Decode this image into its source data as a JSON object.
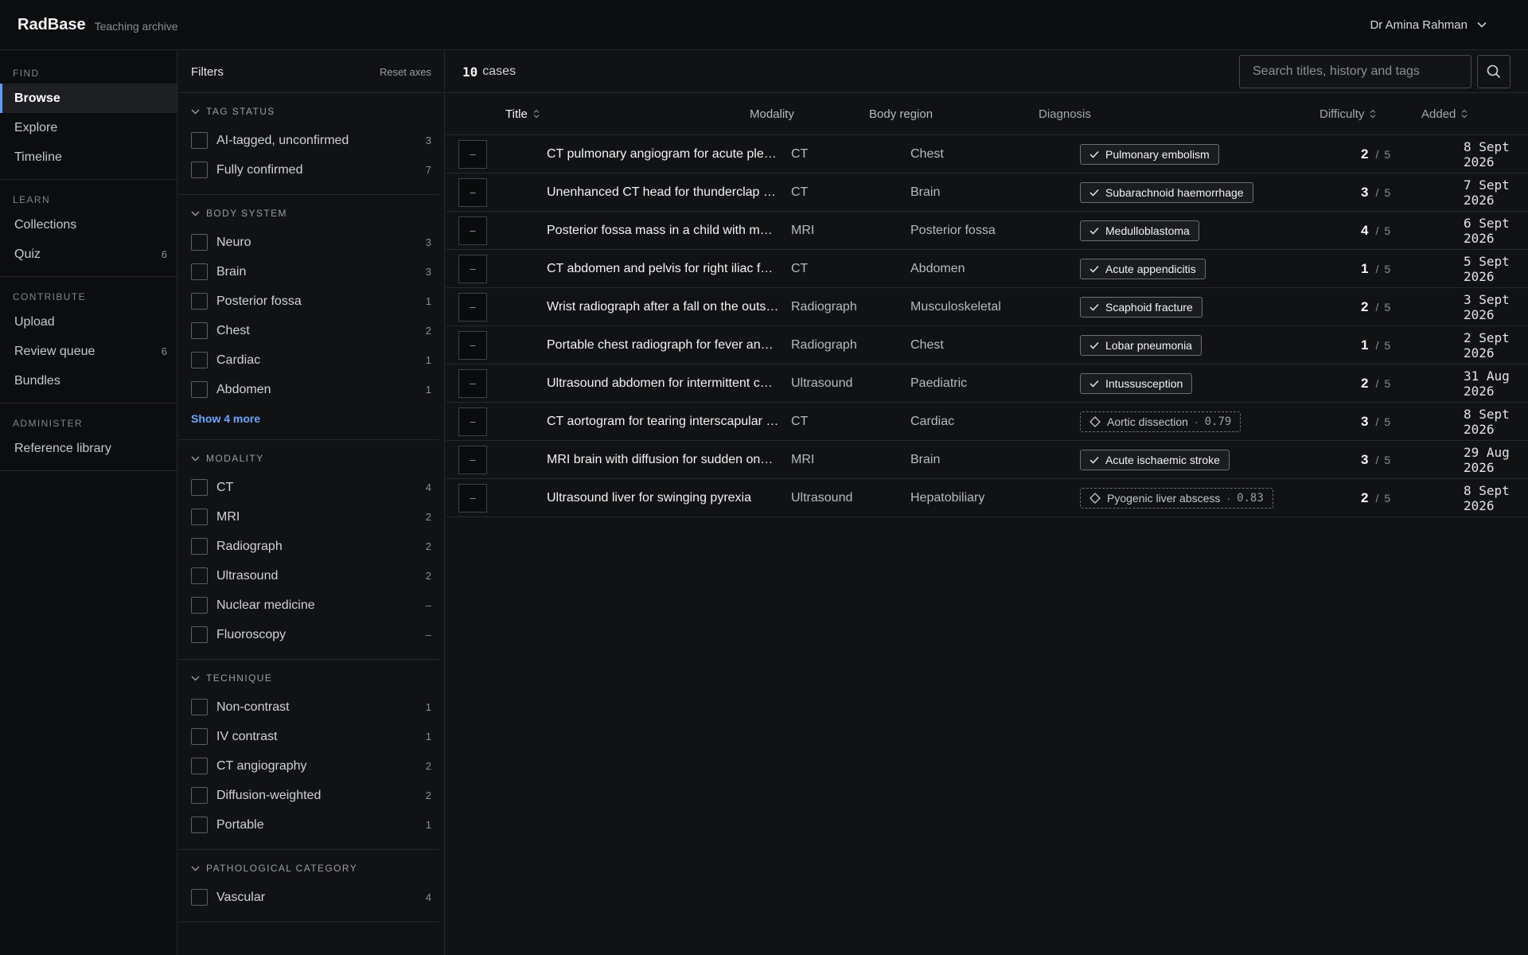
{
  "app": {
    "name": "RadBase",
    "subtitle": "Teaching archive",
    "user": "Dr Amina Rahman"
  },
  "nav": {
    "sections": [
      {
        "heading": "FIND",
        "items": [
          {
            "label": "Browse",
            "active": true
          },
          {
            "label": "Explore"
          },
          {
            "label": "Timeline"
          }
        ]
      },
      {
        "heading": "LEARN",
        "items": [
          {
            "label": "Collections"
          },
          {
            "label": "Quiz",
            "count": "6"
          }
        ]
      },
      {
        "heading": "CONTRIBUTE",
        "items": [
          {
            "label": "Upload"
          },
          {
            "label": "Review queue",
            "count": "6"
          },
          {
            "label": "Bundles"
          }
        ]
      },
      {
        "heading": "ADMINISTER",
        "items": [
          {
            "label": "Reference library"
          }
        ]
      }
    ]
  },
  "filters": {
    "title": "Filters",
    "reset_label": "Reset axes",
    "show_more_label": "Show 4 more",
    "groups": [
      {
        "title": "TAG STATUS",
        "options": [
          {
            "label": "AI-tagged, unconfirmed",
            "count": "3"
          },
          {
            "label": "Fully confirmed",
            "count": "7"
          }
        ]
      },
      {
        "title": "BODY SYSTEM",
        "options": [
          {
            "label": "Neuro",
            "count": "3"
          },
          {
            "label": "Brain",
            "count": "3"
          },
          {
            "label": "Posterior fossa",
            "count": "1"
          },
          {
            "label": "Chest",
            "count": "2"
          },
          {
            "label": "Cardiac",
            "count": "1"
          },
          {
            "label": "Abdomen",
            "count": "1"
          }
        ]
      },
      {
        "title": "MODALITY",
        "options": [
          {
            "label": "CT",
            "count": "4"
          },
          {
            "label": "MRI",
            "count": "2"
          },
          {
            "label": "Radiograph",
            "count": "2"
          },
          {
            "label": "Ultrasound",
            "count": "2"
          },
          {
            "label": "Nuclear medicine",
            "count": "–"
          },
          {
            "label": "Fluoroscopy",
            "count": "–"
          }
        ]
      },
      {
        "title": "TECHNIQUE",
        "options": [
          {
            "label": "Non-contrast",
            "count": "1"
          },
          {
            "label": "IV contrast",
            "count": "1"
          },
          {
            "label": "CT angiography",
            "count": "2"
          },
          {
            "label": "Diffusion-weighted",
            "count": "2"
          },
          {
            "label": "Portable",
            "count": "1"
          }
        ]
      },
      {
        "title": "PATHOLOGICAL CATEGORY",
        "options": [
          {
            "label": "Vascular",
            "count": "4"
          }
        ]
      }
    ]
  },
  "results": {
    "count": "10",
    "count_label": "cases",
    "search_placeholder": "Search titles, history and tags",
    "columns": {
      "title": "Title",
      "modality": "Modality",
      "body_region": "Body region",
      "diagnosis": "Diagnosis",
      "difficulty": "Difficulty",
      "added": "Added"
    },
    "rows": [
      {
        "title": "CT pulmonary angiogram for acute pleuritic chest pain",
        "modality": "CT",
        "body_region": "Chest",
        "diagnosis": "Pulmonary embolism",
        "confirmed": true,
        "difficulty": "2",
        "difficulty_max": "5",
        "added": "8 Sept 2026"
      },
      {
        "title": "Unenhanced CT head for thunderclap headache",
        "modality": "CT",
        "body_region": "Brain",
        "diagnosis": "Subarachnoid haemorrhage",
        "confirmed": true,
        "difficulty": "3",
        "difficulty_max": "5",
        "added": "7 Sept 2026"
      },
      {
        "title": "Posterior fossa mass in a child with morning vomiting",
        "modality": "MRI",
        "body_region": "Posterior fossa",
        "diagnosis": "Medulloblastoma",
        "confirmed": true,
        "difficulty": "4",
        "difficulty_max": "5",
        "added": "6 Sept 2026"
      },
      {
        "title": "CT abdomen and pelvis for right iliac fossa pain",
        "modality": "CT",
        "body_region": "Abdomen",
        "diagnosis": "Acute appendicitis",
        "confirmed": true,
        "difficulty": "1",
        "difficulty_max": "5",
        "added": "5 Sept 2026"
      },
      {
        "title": "Wrist radiograph after a fall on the outstretched hand",
        "modality": "Radiograph",
        "body_region": "Musculoskeletal",
        "diagnosis": "Scaphoid fracture",
        "confirmed": true,
        "difficulty": "2",
        "difficulty_max": "5",
        "added": "3 Sept 2026"
      },
      {
        "title": "Portable chest radiograph for fever and cough",
        "modality": "Radiograph",
        "body_region": "Chest",
        "diagnosis": "Lobar pneumonia",
        "confirmed": true,
        "difficulty": "1",
        "difficulty_max": "5",
        "added": "2 Sept 2026"
      },
      {
        "title": "Ultrasound abdomen for intermittent colicky pain",
        "modality": "Ultrasound",
        "body_region": "Paediatric",
        "diagnosis": "Intussusception",
        "confirmed": true,
        "difficulty": "2",
        "difficulty_max": "5",
        "added": "31 Aug 2026"
      },
      {
        "title": "CT aortogram for tearing interscapular pain",
        "modality": "CT",
        "body_region": "Cardiac",
        "diagnosis": "Aortic dissection",
        "confirmed": false,
        "confidence": "0.79",
        "difficulty": "3",
        "difficulty_max": "5",
        "added": "8 Sept 2026"
      },
      {
        "title": "MRI brain with diffusion for sudden onset weakness",
        "modality": "MRI",
        "body_region": "Brain",
        "diagnosis": "Acute ischaemic stroke",
        "confirmed": true,
        "difficulty": "3",
        "difficulty_max": "5",
        "added": "29 Aug 2026"
      },
      {
        "title": "Ultrasound liver for swinging pyrexia",
        "modality": "Ultrasound",
        "body_region": "Hepatobiliary",
        "diagnosis": "Pyogenic liver abscess",
        "confirmed": false,
        "confidence": "0.83",
        "difficulty": "2",
        "difficulty_max": "5",
        "added": "8 Sept 2026"
      }
    ]
  },
  "colors": {
    "accent": "#5b9bff",
    "link": "#6aa6ff",
    "background": "#111214",
    "panel": "#0c0d0f"
  },
  "icons": {
    "user_menu": "chevron-down-icon",
    "search": "search-icon",
    "group_toggle": "chevron-down-icon",
    "sort": "sort-icon",
    "confirmed": "check-icon",
    "unconfirmed": "diamond-icon"
  }
}
